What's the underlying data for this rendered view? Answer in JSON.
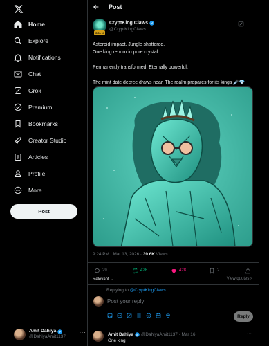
{
  "nav": {
    "items": [
      {
        "label": "Home",
        "icon": "home-icon"
      },
      {
        "label": "Explore",
        "icon": "search-icon"
      },
      {
        "label": "Notifications",
        "icon": "bell-icon"
      },
      {
        "label": "Chat",
        "icon": "mail-icon"
      },
      {
        "label": "Grok",
        "icon": "grok-icon"
      },
      {
        "label": "Premium",
        "icon": "premium-icon"
      },
      {
        "label": "Bookmarks",
        "icon": "bookmark-icon"
      },
      {
        "label": "Creator Studio",
        "icon": "rocket-icon"
      },
      {
        "label": "Articles",
        "icon": "article-icon"
      },
      {
        "label": "Profile",
        "icon": "person-icon"
      },
      {
        "label": "More",
        "icon": "more-circle-icon"
      }
    ],
    "post_button": "Post"
  },
  "account": {
    "name": "Amit Dahiya",
    "handle": "@DahiyaAmit1137",
    "more": "···"
  },
  "header": {
    "title": "Post"
  },
  "tweet": {
    "author": {
      "name": "CryptKing Claws",
      "handle": "@CryptKingClaws",
      "badge": "SOL X"
    },
    "lines": [
      "Asteroid impact. Jungle shattered.",
      "One king reborn in pure crystal.",
      "",
      "Permanently transformed. Eternally powerful.",
      "",
      "The mint date decree draws near. The realm prepares for its kings ☄️💎"
    ],
    "timestamp": "9:24 PM · Mar 13, 2026 · ",
    "views_count": "39.6K",
    "views_label": " Views",
    "stats": {
      "replies": "29",
      "reposts": "428",
      "likes": "428",
      "bookmarks": "2"
    },
    "relevant_label": "Relevant ⌄",
    "view_quotes": "View quotes ›"
  },
  "reply_composer": {
    "replying_to_prefix": "Replying to ",
    "replying_to_handle": "@CryptKingClaws",
    "placeholder": "Post your reply",
    "button": "Reply"
  },
  "reply": {
    "name": "Amit Dahiya",
    "rest": "@DahiyaAmit1137 · Mar 16",
    "text": "One king"
  },
  "colors": {
    "accent": "#1d9bf0",
    "repost": "#00ba7c",
    "like": "#f91880",
    "background": "#000000"
  }
}
